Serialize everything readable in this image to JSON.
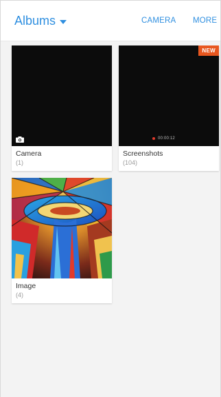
{
  "header": {
    "title": "Albums",
    "camera_label": "CAMERA",
    "more_label": "MORE"
  },
  "albums": [
    {
      "name": "Camera",
      "count": "(1)"
    },
    {
      "name": "Screenshots",
      "count": "(104)",
      "badge": "NEW",
      "duration": "00:00:12"
    },
    {
      "name": "Image",
      "count": "(4)"
    }
  ],
  "colors": {
    "accent": "#2f8fe0",
    "badge": "#e8571f",
    "record_dot": "#e23b2c"
  }
}
